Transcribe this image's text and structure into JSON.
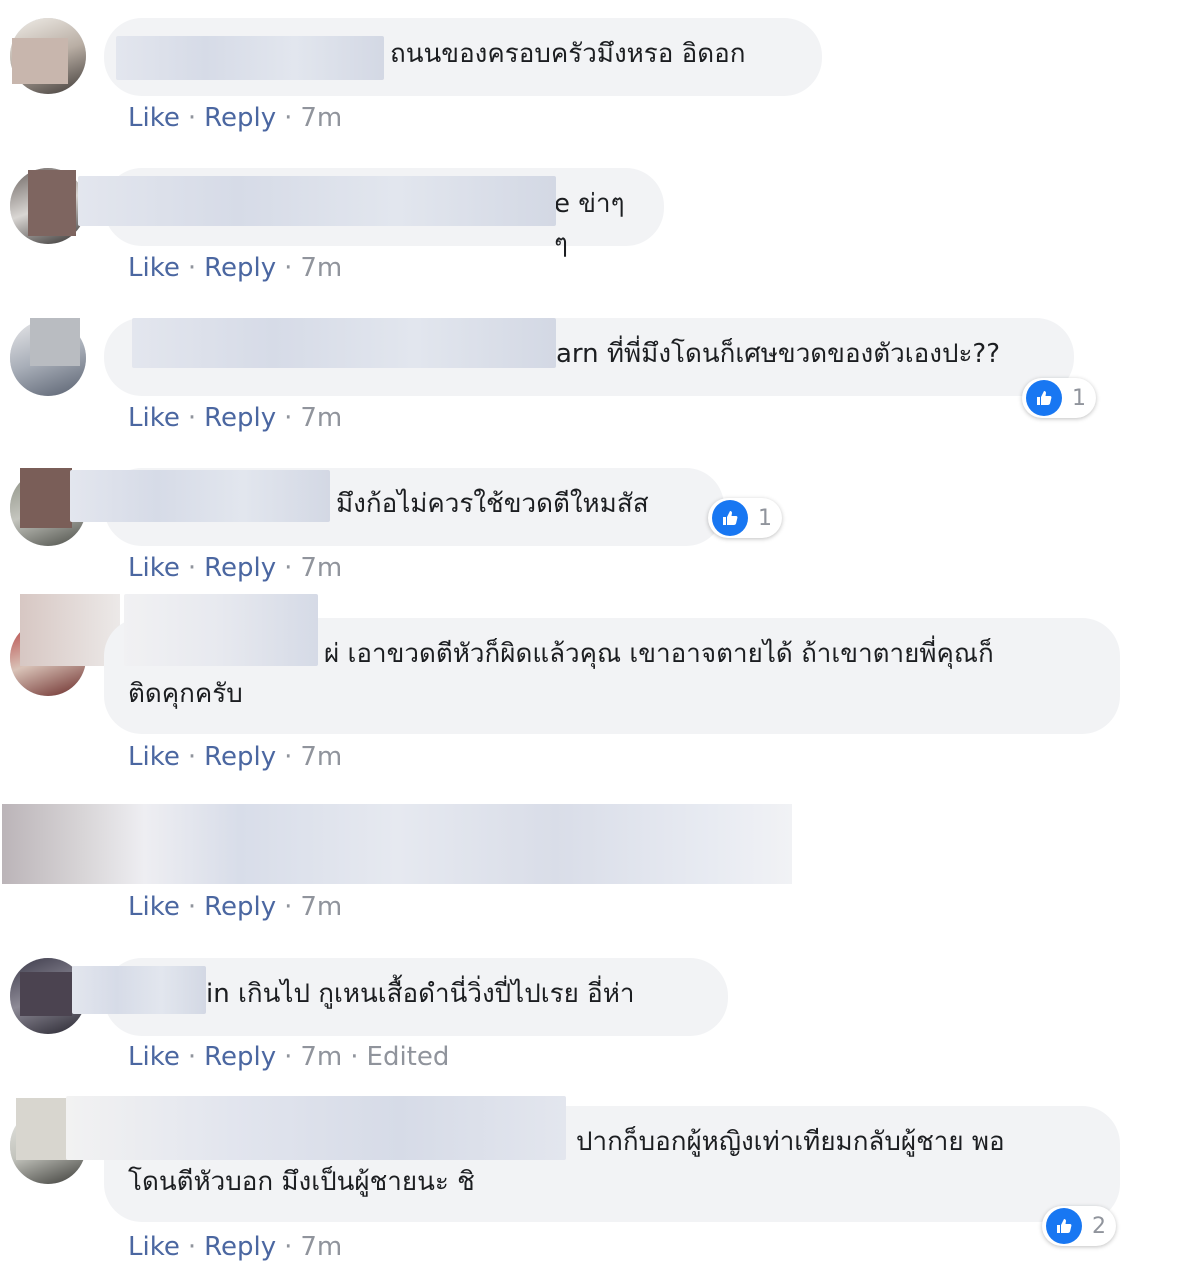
{
  "actions": {
    "like": "Like",
    "reply": "Reply",
    "dot": "·"
  },
  "comments": [
    {
      "text": "ถนนของครอบครัวมึงหรอ อิดอก",
      "time": "7m"
    },
    {
      "text": "e ข่าๆๆ",
      "time": "7m"
    },
    {
      "text": "arn ที่พี่มึงโดนก็เศษขวดของตัวเองปะ??",
      "time": "7m",
      "reactions": "1"
    },
    {
      "text": "มึงก้อไม่ควรใช้ขวดตีใหมสัส",
      "time": "7m",
      "reactions": "1"
    },
    {
      "text": "ผ่ เอาขวดตีหัวก็ผิดแล้วคุณ เขาอาจตายได้ ถ้าเขาตายพี่คุณก็\nติดคุกครับ",
      "time": "7m"
    },
    {
      "text": "",
      "time": "7m"
    },
    {
      "text": "in เกินไป กูเหนเสื้อดำนี่วิ่งปี่ไปเรย อี่ห่า",
      "time": "7m",
      "edited": "Edited"
    },
    {
      "text": "ปากก็บอกผู้หญิงเท่าเทียมกลับผู้ชาย พอ\nโดนตีหัวบอก มึงเป็นผู้ชายนะ ชิ",
      "time": "7m",
      "reactions": "2"
    }
  ],
  "colors": {
    "link": "#4b67a1",
    "meta": "#90949c",
    "bubble": "#f2f3f5",
    "like_blue": "#1877f2"
  },
  "icons": {
    "reaction": "like-thumb-icon"
  }
}
